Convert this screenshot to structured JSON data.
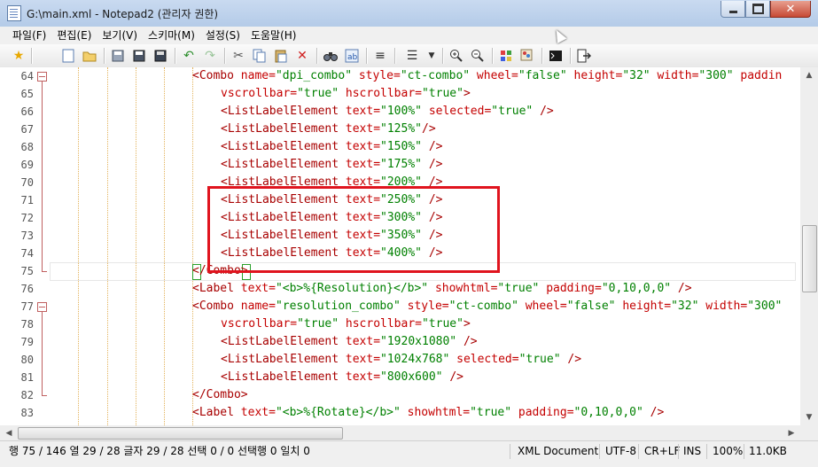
{
  "window": {
    "title": "G:\\main.xml - Notepad2 (관리자 권한)"
  },
  "menu": [
    "파일(F)",
    "편집(E)",
    "보기(V)",
    "스키마(M)",
    "설정(S)",
    "도움말(H)"
  ],
  "toolbar_icons": [
    "favorites-star-icon",
    "new-file-icon",
    "open-file-icon",
    "save-icon",
    "save-as-icon",
    "save-copy-icon",
    "undo-icon",
    "redo-icon",
    "cut-icon",
    "copy-icon",
    "paste-icon",
    "delete-icon",
    "find-icon",
    "replace-icon",
    "word-wrap-icon",
    "view-options-icon",
    "zoom-in-icon",
    "zoom-out-icon",
    "scheme-icon",
    "customize-scheme-icon",
    "terminal-icon",
    "exit-icon"
  ],
  "editor": {
    "lines": [
      {
        "n": "64",
        "fold": "open",
        "indent": 1,
        "tokens": [
          [
            "tag",
            "<Combo "
          ],
          [
            "attr",
            "name="
          ],
          [
            "val",
            "\"dpi_combo\" "
          ],
          [
            "attr",
            "style="
          ],
          [
            "val",
            "\"ct-combo\" "
          ],
          [
            "attr",
            "wheel="
          ],
          [
            "val",
            "\"false\" "
          ],
          [
            "attr",
            "height="
          ],
          [
            "val",
            "\"32\" "
          ],
          [
            "attr",
            "width="
          ],
          [
            "val",
            "\"300\" "
          ],
          [
            "attr",
            "paddin"
          ]
        ]
      },
      {
        "n": "65",
        "indent": 2,
        "tokens": [
          [
            "attr",
            "vscrollbar="
          ],
          [
            "val",
            "\"true\" "
          ],
          [
            "attr",
            "hscrollbar="
          ],
          [
            "val",
            "\"true\""
          ],
          [
            "tag",
            ">"
          ]
        ]
      },
      {
        "n": "66",
        "indent": 2,
        "tokens": [
          [
            "tag",
            "<ListLabelElement "
          ],
          [
            "attr",
            "text="
          ],
          [
            "val",
            "\"100%\" "
          ],
          [
            "attr",
            "selected="
          ],
          [
            "val",
            "\"true\" "
          ],
          [
            "tag",
            "/>"
          ]
        ]
      },
      {
        "n": "67",
        "indent": 2,
        "tokens": [
          [
            "tag",
            "<ListLabelElement "
          ],
          [
            "attr",
            "text="
          ],
          [
            "val",
            "\"125%\""
          ],
          [
            "tag",
            "/>"
          ]
        ]
      },
      {
        "n": "68",
        "indent": 2,
        "tokens": [
          [
            "tag",
            "<ListLabelElement "
          ],
          [
            "attr",
            "text="
          ],
          [
            "val",
            "\"150%\" "
          ],
          [
            "tag",
            "/>"
          ]
        ]
      },
      {
        "n": "69",
        "indent": 2,
        "tokens": [
          [
            "tag",
            "<ListLabelElement "
          ],
          [
            "attr",
            "text="
          ],
          [
            "val",
            "\"175%\" "
          ],
          [
            "tag",
            "/>"
          ]
        ]
      },
      {
        "n": "70",
        "indent": 2,
        "tokens": [
          [
            "tag",
            "<ListLabelElement "
          ],
          [
            "attr",
            "text="
          ],
          [
            "val",
            "\"200%\" "
          ],
          [
            "tag",
            "/>"
          ]
        ]
      },
      {
        "n": "71",
        "indent": 2,
        "tokens": [
          [
            "tag",
            "<ListLabelElement "
          ],
          [
            "attr",
            "text="
          ],
          [
            "val",
            "\"250%\" "
          ],
          [
            "tag",
            "/>"
          ]
        ]
      },
      {
        "n": "72",
        "indent": 2,
        "tokens": [
          [
            "tag",
            "<ListLabelElement "
          ],
          [
            "attr",
            "text="
          ],
          [
            "val",
            "\"300%\" "
          ],
          [
            "tag",
            "/>"
          ]
        ]
      },
      {
        "n": "73",
        "indent": 2,
        "tokens": [
          [
            "tag",
            "<ListLabelElement "
          ],
          [
            "attr",
            "text="
          ],
          [
            "val",
            "\"350%\" "
          ],
          [
            "tag",
            "/>"
          ]
        ]
      },
      {
        "n": "74",
        "indent": 2,
        "tokens": [
          [
            "tag",
            "<ListLabelElement "
          ],
          [
            "attr",
            "text="
          ],
          [
            "val",
            "\"400%\" "
          ],
          [
            "tag",
            "/>"
          ]
        ]
      },
      {
        "n": "75",
        "fold": "end",
        "indent": 1,
        "tokens": [
          [
            "tag",
            "</Combo>"
          ]
        ]
      },
      {
        "n": "76",
        "indent": 1,
        "tokens": [
          [
            "tag",
            "<Label "
          ],
          [
            "attr",
            "text="
          ],
          [
            "val",
            "\"<b>%{Resolution}</b>\" "
          ],
          [
            "attr",
            "showhtml="
          ],
          [
            "val",
            "\"true\" "
          ],
          [
            "attr",
            "padding="
          ],
          [
            "val",
            "\"0,10,0,0\" "
          ],
          [
            "tag",
            "/>"
          ]
        ]
      },
      {
        "n": "77",
        "fold": "open",
        "indent": 1,
        "tokens": [
          [
            "tag",
            "<Combo "
          ],
          [
            "attr",
            "name="
          ],
          [
            "val",
            "\"resolution_combo\" "
          ],
          [
            "attr",
            "style="
          ],
          [
            "val",
            "\"ct-combo\" "
          ],
          [
            "attr",
            "wheel="
          ],
          [
            "val",
            "\"false\" "
          ],
          [
            "attr",
            "height="
          ],
          [
            "val",
            "\"32\" "
          ],
          [
            "attr",
            "width="
          ],
          [
            "val",
            "\"300\""
          ]
        ]
      },
      {
        "n": "78",
        "indent": 2,
        "tokens": [
          [
            "attr",
            "vscrollbar="
          ],
          [
            "val",
            "\"true\" "
          ],
          [
            "attr",
            "hscrollbar="
          ],
          [
            "val",
            "\"true\""
          ],
          [
            "tag",
            ">"
          ]
        ]
      },
      {
        "n": "79",
        "indent": 2,
        "tokens": [
          [
            "tag",
            "<ListLabelElement "
          ],
          [
            "attr",
            "text="
          ],
          [
            "val",
            "\"1920x1080\" "
          ],
          [
            "tag",
            "/>"
          ]
        ]
      },
      {
        "n": "80",
        "indent": 2,
        "tokens": [
          [
            "tag",
            "<ListLabelElement "
          ],
          [
            "attr",
            "text="
          ],
          [
            "val",
            "\"1024x768\" "
          ],
          [
            "attr",
            "selected="
          ],
          [
            "val",
            "\"true\" "
          ],
          [
            "tag",
            "/>"
          ]
        ]
      },
      {
        "n": "81",
        "indent": 2,
        "tokens": [
          [
            "tag",
            "<ListLabelElement "
          ],
          [
            "attr",
            "text="
          ],
          [
            "val",
            "\"800x600\" "
          ],
          [
            "tag",
            "/>"
          ]
        ]
      },
      {
        "n": "82",
        "fold": "end",
        "indent": 1,
        "tokens": [
          [
            "tag",
            "</Combo>"
          ]
        ]
      },
      {
        "n": "83",
        "indent": 1,
        "tokens": [
          [
            "tag",
            "<Label "
          ],
          [
            "attr",
            "text="
          ],
          [
            "val",
            "\"<b>%{Rotate}</b>\" "
          ],
          [
            "attr",
            "showhtml="
          ],
          [
            "val",
            "\"true\" "
          ],
          [
            "attr",
            "padding="
          ],
          [
            "val",
            "\"0,10,0,0\" "
          ],
          [
            "tag",
            "/>"
          ]
        ]
      }
    ]
  },
  "status": {
    "position": "행 75 / 146  열 29 / 28  글자 29 / 28  선택 0 / 0  선택행 0  일치 0",
    "scheme": "XML Document",
    "encoding": "UTF-8",
    "eol": "CR+LF",
    "mode": "INS",
    "zoom": "100%",
    "size": "11.0KB"
  },
  "colors": {
    "tag": "#a80000",
    "attr": "#c40000",
    "value": "#008000",
    "highlight_box": "#e0141e"
  }
}
